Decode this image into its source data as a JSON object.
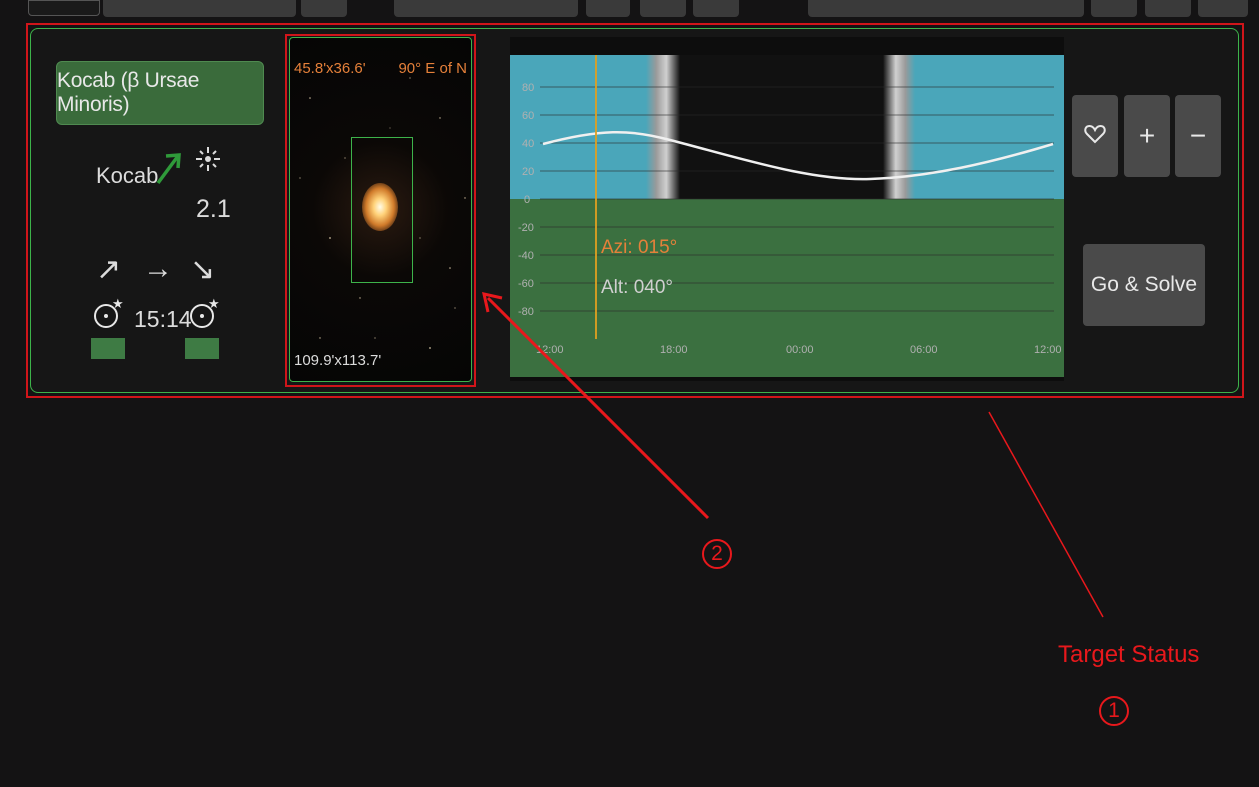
{
  "target": {
    "button_label": "Kocab (β Ursae Minoris)",
    "name": "Kocab",
    "trend_icon": "trend-up-arrow-icon",
    "magnitude_icon": "brightness-icon",
    "magnitude": "2.1",
    "rise_arrow": "↗",
    "transit_arrow": "→",
    "set_arrow": "↘",
    "transit_time": "15:14",
    "rise_icon": "rise-time-icon",
    "set_icon": "set-time-icon"
  },
  "thumbnail": {
    "fov_small": "45.8'x36.6'",
    "rotation": "90° E of N",
    "fov_large": "109.9'x113.7'"
  },
  "altitude_chart": {
    "y_ticks": [
      "80",
      "60",
      "40",
      "20",
      "0",
      "-20",
      "-40",
      "-60",
      "-80"
    ],
    "x_ticks": [
      "12:00",
      "18:00",
      "00:00",
      "06:00",
      "12:00"
    ],
    "azimuth": "Azi: 015°",
    "altitude": "Alt: 040°"
  },
  "actions": {
    "favorite_icon": "heart-icon",
    "zoom_in": "+",
    "zoom_out": "−",
    "go_solve": "Go & Solve"
  },
  "annotations": {
    "target_status_label": "Target Status",
    "marker_1": "1",
    "marker_2": "2"
  },
  "colors": {
    "panel_border": "#3db34a",
    "button_green": "#3a6b3b",
    "annotation_red": "#e8181c",
    "sky_blue": "#4aa6ba",
    "ground_green": "#3b7040",
    "azimuth_orange": "#e5803a"
  }
}
